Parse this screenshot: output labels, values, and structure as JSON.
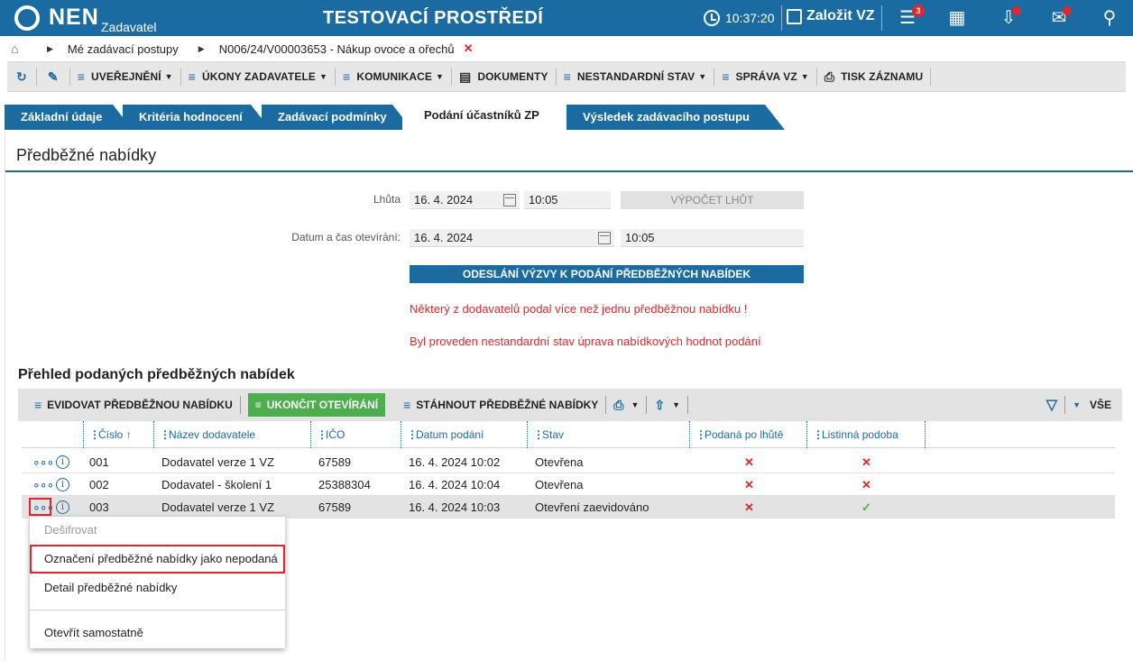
{
  "header": {
    "logo": "NEN",
    "logo_sub": "Zadavatel",
    "env_title": "TESTOVACÍ PROSTŘEDÍ",
    "time": "10:37:20",
    "create_label": "Založit VZ",
    "menu_badge": "3"
  },
  "breadcrumb": {
    "item1": "Mé zadávací postupy",
    "item2": "N006/24/V00003653 - Nákup ovoce a ořechů"
  },
  "actions": {
    "uverejneni": "UVEŘEJNĚNÍ",
    "ukony": "ÚKONY ZADAVATELE",
    "komunikace": "KOMUNIKACE",
    "dokumenty": "DOKUMENTY",
    "nestandardni": "NESTANDARDNÍ STAV",
    "sprava": "SPRÁVA VZ",
    "tisk": "TISK ZÁZNAMU"
  },
  "tabs": {
    "t1": "Základní údaje",
    "t2": "Kritéria hodnocení",
    "t3": "Zadávací podmínky",
    "t4": "Podání účastníků ZP",
    "t5": "Výsledek zadávacího postupu"
  },
  "section": {
    "title": "Předběžné nabídky"
  },
  "form": {
    "lhuta_label": "Lhůta",
    "lhuta_date": "16. 4. 2024",
    "lhuta_time": "10:05",
    "vypocet": "VÝPOČET LHŮT",
    "otevirani_label": "Datum a čas otevírání:",
    "otevirani_date": "16. 4. 2024",
    "otevirani_time": "10:05",
    "odeslani": "ODESLÁNÍ VÝZVY K PODÁNÍ PŘEDBĚŽNÝCH NABÍDEK",
    "warn1": "Některý z dodavatelů podal více než jednu předběžnou nabídku !",
    "warn2": "Byl proveden nestandardní stav úprava nabídkových hodnot podání"
  },
  "grid": {
    "title": "Přehled podaných předběžných nabídek",
    "toolbar": {
      "evidovat": "EVIDOVAT PŘEDBĚŽNOU NABÍDKU",
      "ukoncit": "UKONČIT OTEVÍRÁNÍ",
      "stahnout": "STÁHNOUT PŘEDBĚŽNÉ NABÍDKY",
      "vse": "VŠE"
    },
    "columns": {
      "cislo": "Číslo",
      "nazev": "Název dodavatele",
      "ico": "IČO",
      "datum": "Datum podání",
      "stav": "Stav",
      "po_lhute": "Podaná po lhůtě",
      "listinna": "Listinná podoba"
    },
    "rows": [
      {
        "cislo": "001",
        "nazev": "Dodavatel verze 1 VZ",
        "ico": "67589",
        "datum": "16. 4. 2024 10:02",
        "stav": "Otevřena",
        "po_lhute": "✕",
        "listinna": "✕"
      },
      {
        "cislo": "002",
        "nazev": "Dodavatel - školení 1",
        "ico": "25388304",
        "datum": "16. 4. 2024 10:04",
        "stav": "Otevřena",
        "po_lhute": "✕",
        "listinna": "✕"
      },
      {
        "cislo": "003",
        "nazev": "Dodavatel verze 1 VZ",
        "ico": "67589",
        "datum": "16. 4. 2024 10:03",
        "stav": "Otevření zaevidováno",
        "po_lhute": "✕",
        "listinna": "✓"
      }
    ]
  },
  "context_menu": {
    "desifrovat": "Dešifrovat",
    "oznaceni": "Označení předběžné nabídky jako nepodaná",
    "detail": "Detail předběžné nabídky",
    "otevrit": "Otevřít samostatně"
  },
  "colors": {
    "primary": "#1b6ba3",
    "danger": "#e3262b",
    "success": "#4cae4c"
  }
}
